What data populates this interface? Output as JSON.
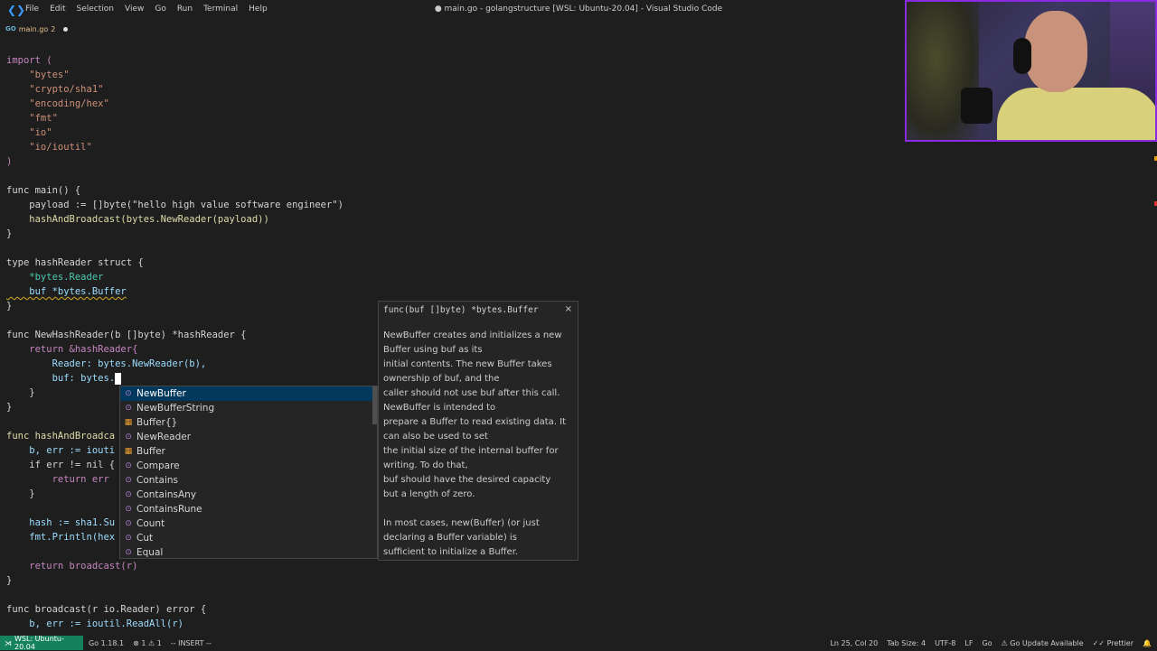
{
  "titlebar": {
    "menu": [
      "File",
      "Edit",
      "Selection",
      "View",
      "Go",
      "Run",
      "Terminal",
      "Help"
    ],
    "window_title": "● main.go - golangstructure [WSL: Ubuntu-20.04] - Visual Studio Code"
  },
  "tab": {
    "icon_text": "GO",
    "filename": "main.go",
    "problems_badge": "2"
  },
  "code": [
    "import (",
    "    \"bytes\"",
    "    \"crypto/sha1\"",
    "    \"encoding/hex\"",
    "    \"fmt\"",
    "    \"io\"",
    "    \"io/ioutil\"",
    ")",
    "func main() {",
    "    payload := []byte(\"hello high value software engineer\")",
    "    hashAndBroadcast(bytes.NewReader(payload))",
    "}",
    "type hashReader struct {",
    "    *bytes.Reader",
    "    buf *bytes.Buffer",
    "}",
    "func NewHashReader(b []byte) *hashReader {",
    "    return &hashReader{",
    "        Reader: bytes.NewReader(b),",
    "        buf: bytes.",
    "    }",
    "}",
    "func hashAndBroadca",
    "    b, err := iouti",
    "    if err != nil {",
    "        return err",
    "    }",
    "    hash := sha1.Su",
    "    fmt.Println(hex",
    "    return broadcast(r)",
    "}",
    "func broadcast(r io.Reader) error {",
    "    b, err := ioutil.ReadAll(r)"
  ],
  "suggestions": {
    "typed_prefix": "",
    "items": [
      {
        "label": "NewBuffer",
        "kind": "function"
      },
      {
        "label": "NewBufferString",
        "kind": "function"
      },
      {
        "label": "Buffer{}",
        "kind": "struct"
      },
      {
        "label": "NewReader",
        "kind": "function"
      },
      {
        "label": "Buffer",
        "kind": "struct"
      },
      {
        "label": "Compare",
        "kind": "function"
      },
      {
        "label": "Contains",
        "kind": "function"
      },
      {
        "label": "ContainsAny",
        "kind": "function"
      },
      {
        "label": "ContainsRune",
        "kind": "function"
      },
      {
        "label": "Count",
        "kind": "function"
      },
      {
        "label": "Cut",
        "kind": "function"
      },
      {
        "label": "Equal",
        "kind": "function"
      }
    ]
  },
  "docs": {
    "signature": "func(buf []byte) *bytes.Buffer",
    "close": "×",
    "lines_para1": [
      "NewBuffer creates and initializes a new",
      "Buffer using buf as its",
      "initial contents. The new Buffer takes",
      "ownership of buf, and the",
      "caller should not use buf after this call.",
      "NewBuffer is intended to",
      "prepare a Buffer to read existing data. It",
      "can also be used to set",
      "the initial size of the internal buffer for",
      "writing. To do that,",
      "buf should have the desired capacity",
      "but a length of zero."
    ],
    "lines_para2": [
      "In most cases, new(Buffer) (or just",
      "declaring a Buffer variable) is",
      "sufficient to initialize a Buffer."
    ]
  },
  "statusbar": {
    "remote": "WSL: Ubuntu-20.04",
    "go_version": "Go 1.18.1",
    "errors": "1",
    "warnings": "1",
    "mode": "-- INSERT --",
    "position": "Ln 25, Col 20",
    "tab_size": "Tab Size: 4",
    "encoding": "UTF-8",
    "eol": "LF",
    "language": "Go",
    "go_update": "Go Update Available",
    "formatter": "Prettier"
  }
}
